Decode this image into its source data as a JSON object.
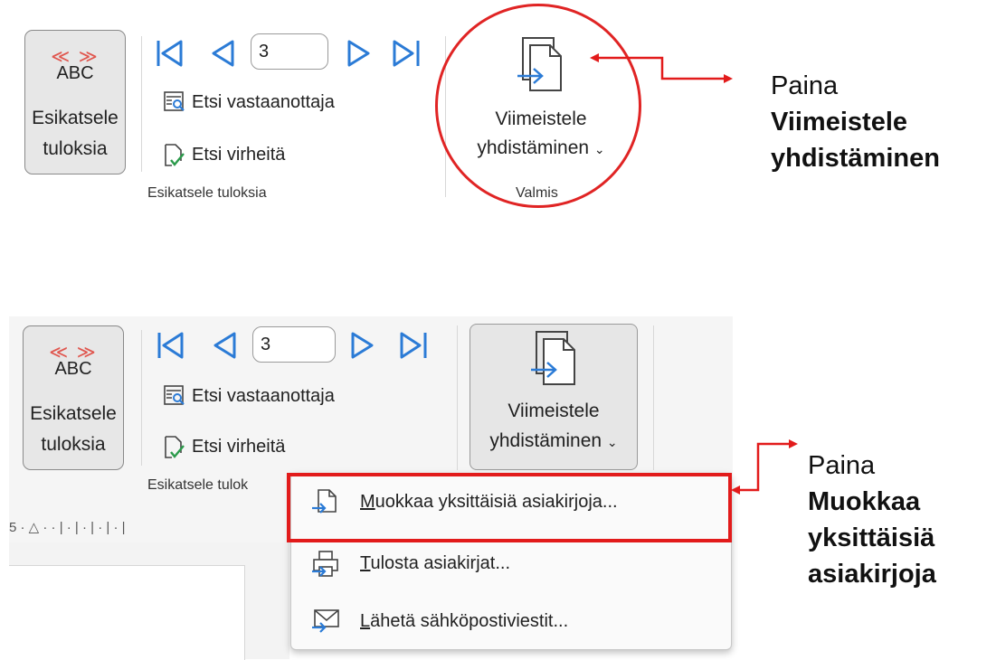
{
  "top_ribbon": {
    "preview_button": {
      "arrows": "≪ ≫",
      "abc": "ABC",
      "line1": "Esikatsele",
      "line2": "tuloksia"
    },
    "nav": {
      "first": "first-record",
      "prev": "previous-record",
      "record_value": "3",
      "next": "next-record",
      "last": "last-record"
    },
    "find_recipient": "Etsi vastaanottaja",
    "find_errors": "Etsi virheitä",
    "group_label": "Esikatsele tuloksia",
    "finish_line1": "Viimeistele",
    "finish_line2": "yhdistäminen",
    "finish_group_label": "Valmis"
  },
  "callout_top": {
    "line1": "Paina",
    "line2": "Viimeistele",
    "line3": "yhdistäminen"
  },
  "bottom_ribbon": {
    "preview_button": {
      "arrows": "≪ ≫",
      "abc": "ABC",
      "line1": "Esikatsele",
      "line2": "tuloksia"
    },
    "record_value": "3",
    "find_recipient": "Etsi vastaanottaja",
    "find_errors": "Etsi virheitä",
    "group_label_partial": "Esikatsele tulok",
    "finish_line1": "Viimeistele",
    "finish_line2": "yhdistäminen",
    "ruler_text": "5 · △ · · | · | · | · | · |"
  },
  "dropdown_menu": {
    "items": [
      {
        "label_first": "M",
        "label_rest": "uokkaa yksittäisiä asiakirjoja...",
        "icon": "edit-documents-icon"
      },
      {
        "label_first": "T",
        "label_rest": "ulosta asiakirjat...",
        "icon": "print-icon"
      },
      {
        "label_first": "L",
        "label_rest": "ähetä sähköpostiviestit...",
        "icon": "email-icon"
      }
    ]
  },
  "callout_bottom": {
    "line1": "Paina",
    "line2": "Muokkaa",
    "line3": "yksittäisiä",
    "line4": "asiakirjoja"
  },
  "colors": {
    "accent_blue": "#2b7bd6",
    "annotation_red": "#e21b1b",
    "arrow_red": "#e0564e"
  }
}
